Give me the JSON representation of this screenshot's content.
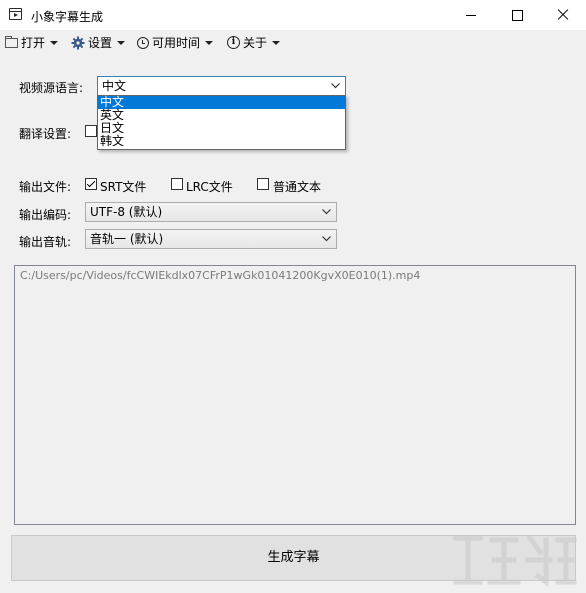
{
  "window": {
    "title": "小象字幕生成"
  },
  "menu": {
    "open": "打开",
    "settings": "设置",
    "time": "可用时间",
    "about": "关于"
  },
  "form": {
    "source_language_label": "视频源语言:",
    "source_language_value": "中文",
    "source_language_options": [
      "中文",
      "英文",
      "日文",
      "韩文"
    ],
    "translate_label": "翻译设置:",
    "output_file_label": "输出文件:",
    "output_file_options": [
      {
        "label": "SRT文件",
        "checked": true
      },
      {
        "label": "LRC文件",
        "checked": false
      },
      {
        "label": "普通文本",
        "checked": false
      }
    ],
    "encoding_label": "输出编码:",
    "encoding_value": "UTF-8  (默认)",
    "audio_track_label": "输出音轨:",
    "audio_track_value": "音轨一 (默认)"
  },
  "file_list": {
    "path": "C:/Users/pc/Videos/fcCWIEkdlx07CFrP1wGk01041200KgvX0E010(1).mp4"
  },
  "generate_button": "生成字幕",
  "colors": {
    "selection": "#0078d7",
    "focus_border": "#3c7fb1",
    "window_bg": "#f0f0f0"
  },
  "icons": [
    "app-icon",
    "folder-icon",
    "gear-icon",
    "clock-icon",
    "info-icon",
    "chevron-down-icon"
  ]
}
